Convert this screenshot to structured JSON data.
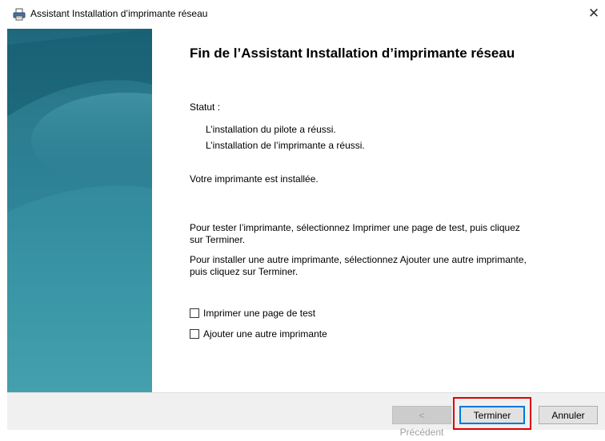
{
  "window": {
    "title": "Assistant Installation d’imprimante réseau",
    "icon": "printer-icon",
    "close_glyph": "✕"
  },
  "main": {
    "heading": "Fin de l’Assistant Installation d’imprimante réseau",
    "status_label": "Statut :",
    "status_lines": [
      "L’installation du pilote a réussi.",
      "L’installation de l’imprimante a réussi."
    ],
    "installed_text": "Votre imprimante est installée.",
    "test_instruction": "Pour tester l’imprimante, sélectionnez Imprimer une page de test, puis cliquez sur Terminer.",
    "add_instruction": "Pour installer une autre imprimante, sélectionnez Ajouter une autre imprimante, puis cliquez sur Terminer.",
    "checkboxes": [
      {
        "label": "Imprimer une page de test",
        "checked": false
      },
      {
        "label": "Ajouter une autre imprimante",
        "checked": false
      }
    ]
  },
  "footer": {
    "back_label": "< Précédent",
    "finish_label": "Terminer",
    "cancel_label": "Annuler"
  },
  "colors": {
    "banner_dark": "#1e677c",
    "banner_light": "#4aa5b1",
    "focus_blue": "#0078d7",
    "annotation_red": "#e00000"
  }
}
